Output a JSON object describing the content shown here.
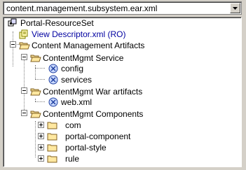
{
  "file_selector": {
    "value": "content.management.subsystem.ear.xml"
  },
  "tree": {
    "root": "Portal-ResourceSet",
    "view_descriptor": "View Descriptor.xml (RO)",
    "artifacts": "Content Management Artifacts",
    "service": "ContentMgmt Service",
    "config": "config",
    "services": "services",
    "war": "ContentMgmt War artifacts",
    "webxml": "web.xml",
    "components": "ContentMgmt Components",
    "com": "com",
    "portal_component": "portal-component",
    "portal_style": "portal-style",
    "rule": "rule"
  }
}
